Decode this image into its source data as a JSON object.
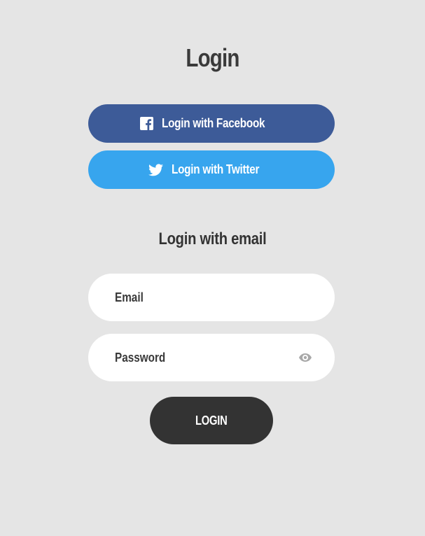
{
  "page": {
    "title": "Login",
    "background_color": "#e5e5e5"
  },
  "social": {
    "facebook": {
      "label": "Login with Facebook",
      "icon": "facebook-icon",
      "color": "#3d5b98"
    },
    "twitter": {
      "label": "Login with Twitter",
      "icon": "twitter-icon",
      "color": "#37a5ee"
    }
  },
  "email_section": {
    "heading": "Login with email",
    "email": {
      "placeholder": "Email",
      "value": ""
    },
    "password": {
      "placeholder": "Password",
      "value": "",
      "toggle_icon": "eye-icon"
    },
    "submit_label": "LOGIN",
    "submit_color": "#333333"
  }
}
